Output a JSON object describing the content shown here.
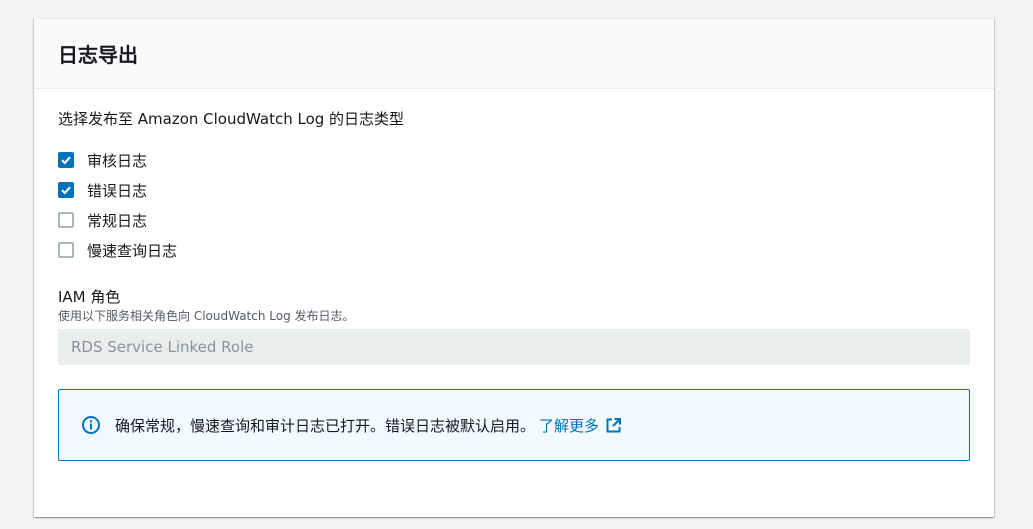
{
  "panel": {
    "title": "日志导出"
  },
  "log_types": {
    "description": "选择发布至 Amazon CloudWatch Log 的日志类型",
    "items": [
      {
        "label": "审核日志",
        "checked": true
      },
      {
        "label": "错误日志",
        "checked": true
      },
      {
        "label": "常规日志",
        "checked": false
      },
      {
        "label": "慢速查询日志",
        "checked": false
      }
    ]
  },
  "iam_role": {
    "label": "IAM 角色",
    "description": "使用以下服务相关角色向 CloudWatch Log 发布日志。",
    "value": "RDS Service Linked Role"
  },
  "alert": {
    "icon": "info-icon",
    "text": "确保常规，慢速查询和审计日志已打开。错误日志被默认启用。",
    "link_label": "了解更多",
    "link_icon": "external-link-icon"
  },
  "colors": {
    "accent": "#0073bb",
    "alert_bg": "#f1faff"
  }
}
